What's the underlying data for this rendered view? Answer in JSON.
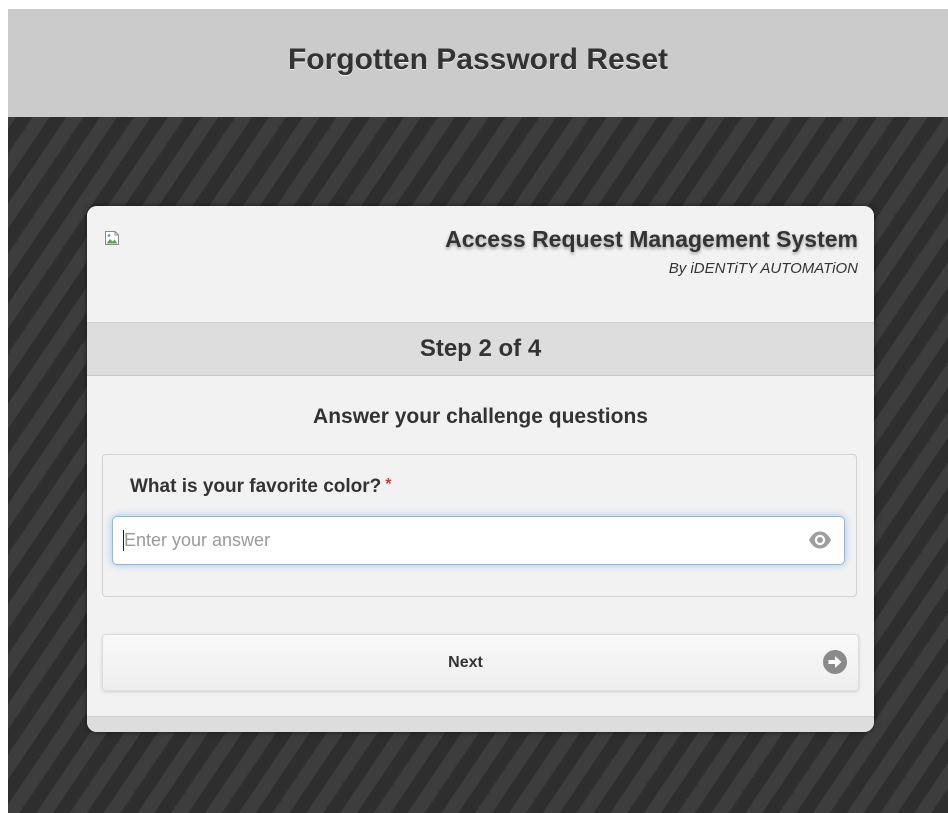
{
  "page_header": {
    "title": "Forgotten Password Reset"
  },
  "brand": {
    "title": "Access Request Management System",
    "subtitle": "By iDENTiTY AUTOMATiON",
    "logo_icon": "broken-image-icon"
  },
  "step": {
    "label": "Step 2 of 4"
  },
  "challenge": {
    "heading": "Answer your challenge questions",
    "question": "What is your favorite color?",
    "required_marker": "*",
    "answer_value": "",
    "answer_placeholder": "Enter your answer",
    "reveal_icon": "eye-icon"
  },
  "actions": {
    "next_label": "Next",
    "next_icon": "arrow-right-circle-icon"
  },
  "colors": {
    "header_bg": "#cbcbcb",
    "stage_bg": "#2e2e2e",
    "card_bg": "#f2f2f2",
    "step_bar_bg": "#dddddd",
    "required": "#e2342b",
    "focus_border": "#8fb8e6",
    "text": "#333333"
  }
}
